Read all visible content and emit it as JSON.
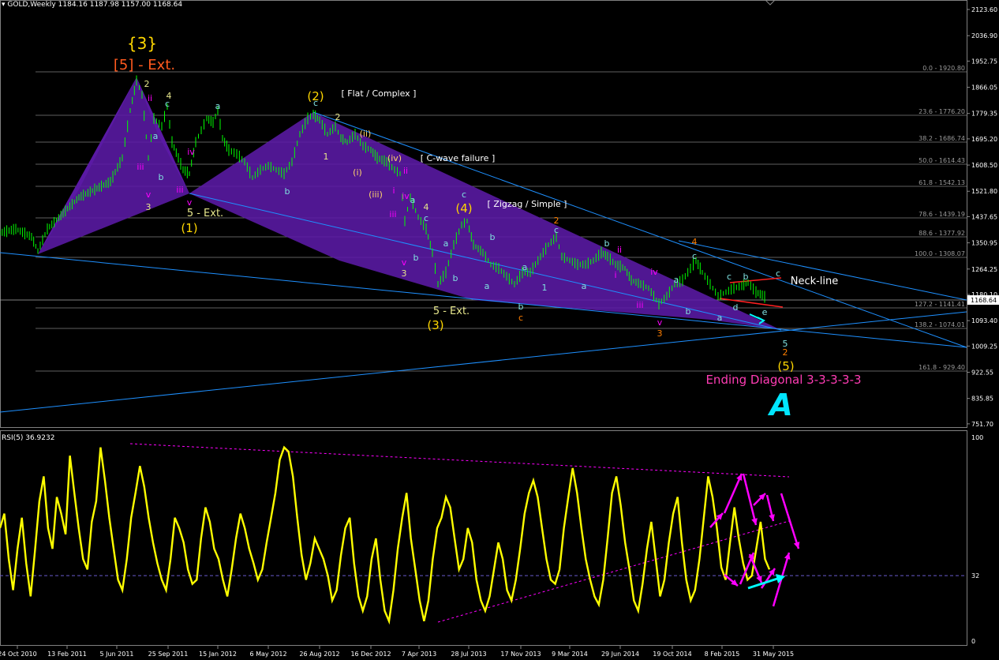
{
  "window": {
    "symbol_title": "GOLD,Weekly",
    "ohlc": "1184.16 1187.98 1157.00 1168.64"
  },
  "colors": {
    "background": "#000000",
    "candle": "#00ff00",
    "fib": "#7f7f7f",
    "trend": "#1e90ff",
    "rsi": "#ffff00",
    "ew_yellow": "#ffd700",
    "ew_orange": "#ff7f00",
    "ew_magenta": "#ff00ff",
    "ew_cyan": "#00ffff",
    "ew_green": "#90ee90",
    "wedge": "#5b1aa6"
  },
  "price_axis": {
    "labels": [
      "2123.60",
      "2036.90",
      "1952.75",
      "1866.05",
      "1779.35",
      "1695.20",
      "1608.50",
      "1521.80",
      "1437.65",
      "1350.95",
      "1264.25",
      "1180.10",
      "1093.40",
      "1009.25",
      "922.55",
      "835.85",
      "751.70"
    ],
    "current": "1168.64",
    "ylim": [
      751.7,
      2123.6
    ]
  },
  "rsi": {
    "title": "RSI(5) 36.9232",
    "axis_labels": [
      "100",
      "32",
      "0"
    ],
    "levels": [
      32
    ]
  },
  "time_axis": {
    "labels": [
      "24 Oct 2010",
      "13 Feb 2011",
      "5 Jun 2011",
      "25 Sep 2011",
      "15 Jan 2012",
      "6 May 2012",
      "26 Aug 2012",
      "16 Dec 2012",
      "7 Apr 2013",
      "28 Jul 2013",
      "17 Nov 2013",
      "9 Mar 2014",
      "29 Jun 2014",
      "19 Oct 2014",
      "8 Feb 2015",
      "31 May 2015"
    ]
  },
  "fib_levels": [
    {
      "label": "0.0 - 1920.80",
      "price": 1920.8
    },
    {
      "label": "23.6 - 1776.20",
      "price": 1776.2
    },
    {
      "label": "38.2 - 1686.74",
      "price": 1686.74
    },
    {
      "label": "50.0 - 1614.43",
      "price": 1614.43
    },
    {
      "label": "61.8 - 1542.13",
      "price": 1542.13
    },
    {
      "label": "78.6 - 1439.19",
      "price": 1439.19
    },
    {
      "label": "88.6 - 1377.92",
      "price": 1377.92
    },
    {
      "label": "100.0 - 1308.07",
      "price": 1308.07
    },
    {
      "label": "127.2 - 1141.41",
      "price": 1141.41
    },
    {
      "label": "138.2 - 1074.01",
      "price": 1074.01
    },
    {
      "label": "161.8 - 929.40",
      "price": 929.4
    }
  ],
  "annotations": [
    {
      "text": "{3}",
      "color": "#ffd700",
      "size": 20
    },
    {
      "text": "[5] - Ext.",
      "color": "#ff5a1e",
      "size": 18
    },
    {
      "text": "(1)",
      "color": "#ffd700",
      "size": 15
    },
    {
      "text": "5 - Ext.",
      "color": "#e6e68c",
      "size": 13
    },
    {
      "text": "(2)",
      "color": "#ffd700",
      "size": 15
    },
    {
      "text": "[ Flat / Complex ]",
      "color": "#ffffff",
      "size": 11
    },
    {
      "text": "[ C-wave failure ]",
      "color": "#ffffff",
      "size": 11
    },
    {
      "text": "(4)",
      "color": "#ffd700",
      "size": 15
    },
    {
      "text": "[ Zigzag / Simple ]",
      "color": "#ffffff",
      "size": 11
    },
    {
      "text": "(3)",
      "color": "#ffd700",
      "size": 15
    },
    {
      "text": "5 - Ext.",
      "color": "#e6e68c",
      "size": 13
    },
    {
      "text": "Neck-line",
      "color": "#ffffff",
      "size": 13
    },
    {
      "text": "(5)",
      "color": "#ffd700",
      "size": 15
    },
    {
      "text": "Ending Diagonal 3-3-3-3-3",
      "color": "#ff3cb4",
      "size": 15
    },
    {
      "text": "A",
      "color": "#00e5ff",
      "size": 38
    }
  ],
  "wave_labels": [
    "2",
    "ii",
    "4",
    "c",
    "iii",
    "a",
    "b",
    "iv",
    "v",
    "3",
    "iii",
    "v",
    "a",
    "b",
    "c",
    "2",
    "1",
    "(ii)",
    "(i)",
    "(iv)",
    "ii",
    "(iii)",
    "iv",
    "i",
    "iii",
    "a",
    "4",
    "c",
    "b",
    "v",
    "3",
    "a",
    "b",
    "c",
    "2",
    "c",
    "b",
    "a",
    "a",
    "b",
    "c",
    "1",
    "b",
    "a",
    "ii",
    "i",
    "iv",
    "v",
    "iii",
    "3",
    "4",
    "c",
    "b",
    "a",
    "a",
    "c",
    "b",
    "d",
    "e",
    "c",
    "5",
    "2"
  ]
}
